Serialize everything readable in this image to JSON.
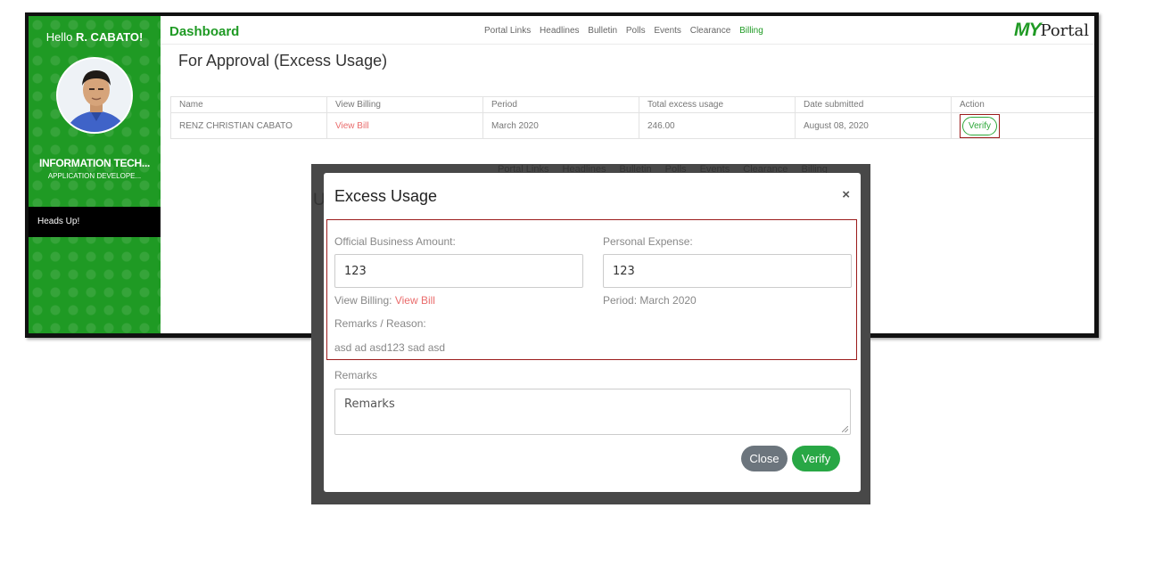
{
  "sidebar": {
    "hello_prefix": "Hello",
    "user_name": "R. CABATO!",
    "department": "INFORMATION TECH...",
    "role": "APPLICATION DEVELOPE...",
    "heads_up": "Heads Up!"
  },
  "header": {
    "title": "Dashboard",
    "nav": [
      "Portal Links",
      "Headlines",
      "Bulletin",
      "Polls",
      "Events",
      "Clearance",
      "Billing"
    ],
    "active_nav": "Billing",
    "brand_my": "MY",
    "brand_portal": "Portal"
  },
  "page": {
    "title": "For Approval (Excess Usage)"
  },
  "table": {
    "headers": [
      "Name",
      "View Billing",
      "Period",
      "Total excess usage",
      "Date submitted",
      "Action"
    ],
    "rows": [
      {
        "name": "RENZ CHRISTIAN CABATO",
        "view_billing": "View Bill",
        "period": "March 2020",
        "total": "246.00",
        "date": "August 08, 2020",
        "action": "Verify"
      }
    ]
  },
  "background_modal": {
    "nav": [
      "Portal Links",
      "Headlines",
      "Bulletin",
      "Polls",
      "Events",
      "Clearance",
      "Billing"
    ],
    "partial_heading": "U"
  },
  "modal": {
    "title": "Excess Usage",
    "close_symbol": "×",
    "official_label": "Official Business Amount:",
    "official_value": "123",
    "personal_label": "Personal Expense:",
    "personal_value": "123",
    "view_billing_label": "View Billing:",
    "view_billing_link": "View Bill",
    "period_text": "Period: March 2020",
    "reason_label": "Remarks / Reason:",
    "reason_text": "asd ad asd123 sad asd",
    "remarks_label": "Remarks",
    "remarks_placeholder": "Remarks",
    "close_button": "Close",
    "verify_button": "Verify"
  },
  "colors": {
    "brand_green": "#1f9a24",
    "link_red": "#ea6c6c",
    "highlight_border": "#9b1b1b",
    "verify_green": "#28a745",
    "close_gray": "#6c757d"
  }
}
